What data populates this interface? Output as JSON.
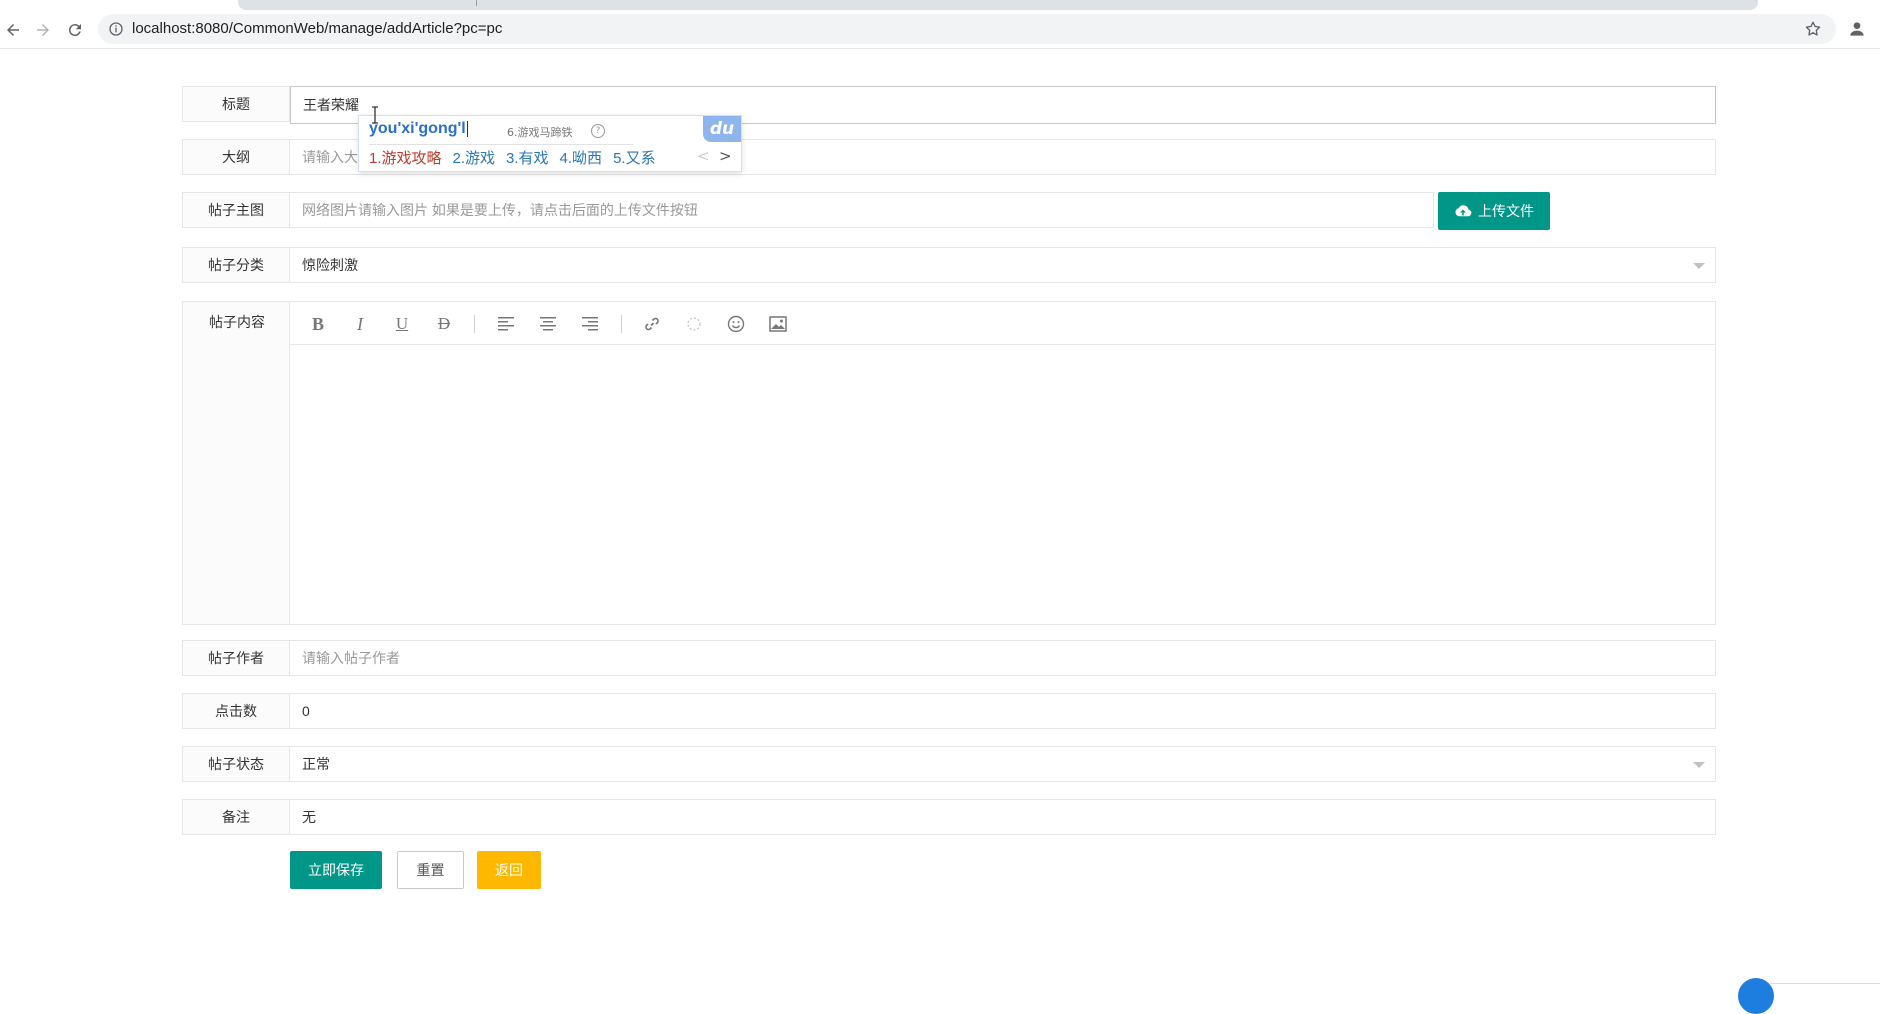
{
  "browser": {
    "url": "localhost:8080/CommonWeb/manage/addArticle?pc=pc",
    "icons": [
      "back-arrow-icon",
      "forward-arrow-icon",
      "reload-icon",
      "info-icon",
      "star-icon",
      "profile-icon"
    ]
  },
  "form": {
    "title": {
      "label": "标题",
      "value": "王者荣耀"
    },
    "outline": {
      "label": "大纲",
      "placeholder": "请输入大"
    },
    "main_image": {
      "label": "帖子主图",
      "placeholder": "网络图片请输入图片 如果是要上传，请点击后面的上传文件按钮",
      "upload_label": "上传文件"
    },
    "category": {
      "label": "帖子分类",
      "value": "惊险刺激"
    },
    "content": {
      "label": "帖子内容",
      "tools": [
        "bold",
        "italic",
        "underline",
        "strikethrough",
        "align-left",
        "align-center",
        "align-right",
        "link",
        "unlink",
        "emoji",
        "image"
      ]
    },
    "author": {
      "label": "帖子作者",
      "placeholder": "请输入帖子作者"
    },
    "clicks": {
      "label": "点击数",
      "value": "0"
    },
    "status": {
      "label": "帖子状态",
      "value": "正常"
    },
    "remark": {
      "label": "备注",
      "value": "无"
    },
    "buttons": {
      "save": "立即保存",
      "reset": "重置",
      "back": "返回"
    }
  },
  "ime": {
    "composition": "you'xi'gong'l",
    "extra_candidate": "6.游戏马蹄铁",
    "help": "?",
    "logo": "du",
    "candidates": [
      "1.游戏攻略",
      "2.游戏",
      "3.有戏",
      "4.呦西",
      "5.又系"
    ],
    "prev": "<",
    "next": ">"
  },
  "colors": {
    "primary": "#009688",
    "warning": "#FFB800",
    "ime_accent": "#2a6fce"
  }
}
